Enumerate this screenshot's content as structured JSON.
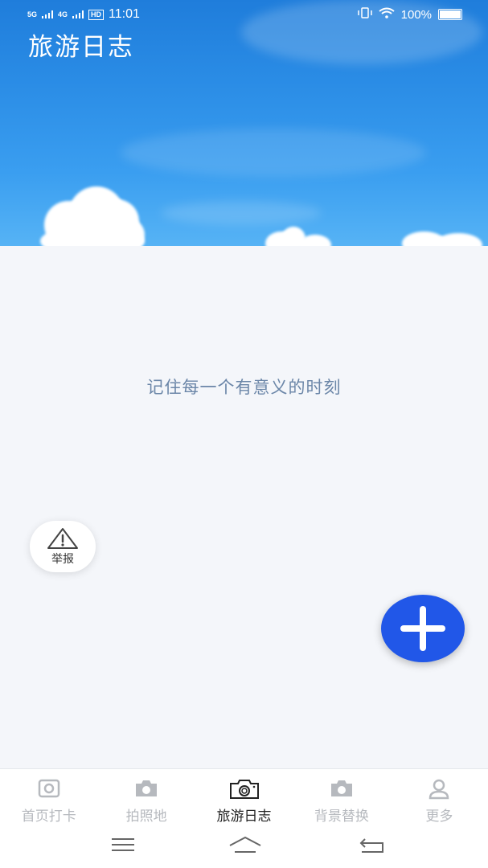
{
  "status_bar": {
    "signal_1": "5G",
    "signal_2": "4G",
    "hd_badge": "HD",
    "time": "11:01",
    "battery_percent": "100%",
    "icons": [
      "vibrate-icon",
      "wifi-icon",
      "battery-icon"
    ]
  },
  "header": {
    "title": "旅游日志"
  },
  "main": {
    "empty_message": "记住每一个有意义的时刻"
  },
  "report_button": {
    "label": "举报",
    "icon": "warning-icon"
  },
  "fab": {
    "icon": "plus-icon",
    "color": "#2157e8"
  },
  "tabbar": {
    "active_index": 2,
    "items": [
      {
        "label": "首页打卡",
        "icon": "instagram-icon"
      },
      {
        "label": "拍照地",
        "icon": "camera-icon"
      },
      {
        "label": "旅游日志",
        "icon": "camera-outline-icon"
      },
      {
        "label": "背景替换",
        "icon": "camera-icon"
      },
      {
        "label": "更多",
        "icon": "person-icon"
      }
    ]
  },
  "colors": {
    "accent": "#2157e8",
    "empty_text": "#6b86a8",
    "tab_inactive": "#b6b9be",
    "tab_active": "#222222"
  }
}
